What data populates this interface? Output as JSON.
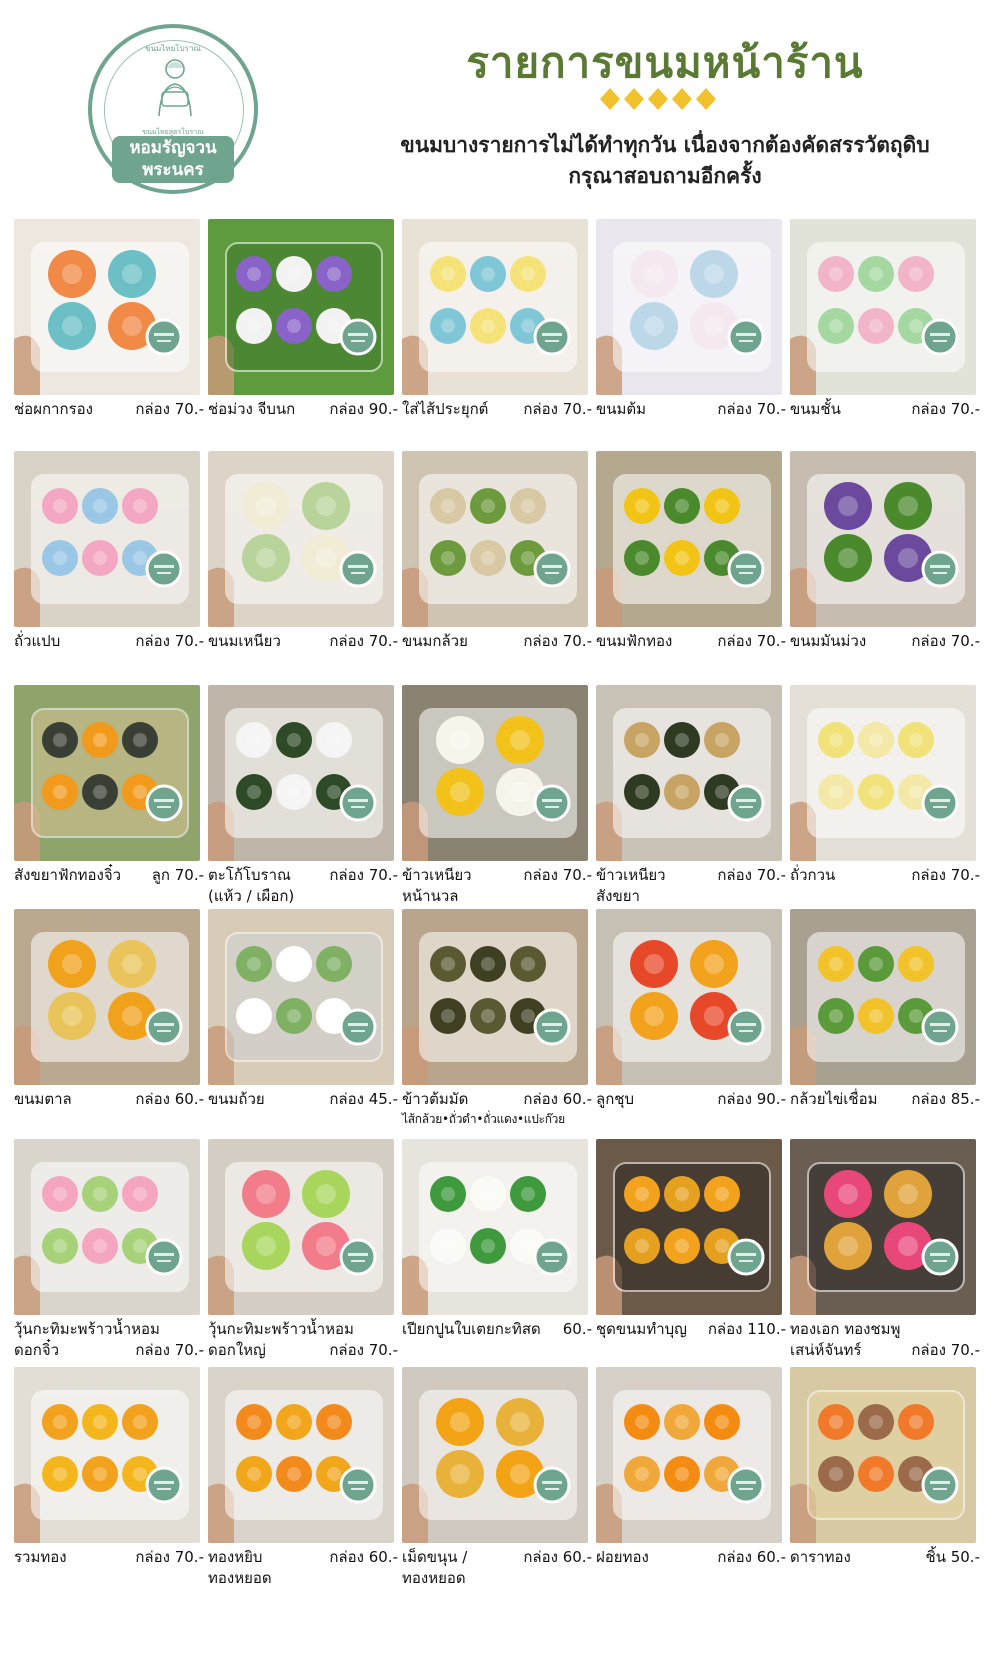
{
  "header": {
    "logo_top_text": "ขนมไทยโบราณ",
    "logo_mid_text": "ขนมไทยสูตรโบราณ",
    "logo_name_line1": "หอมรัญจวน",
    "logo_name_line2": "พระนคร",
    "title": "รายการขนมหน้าร้าน",
    "subtitle_line1": "ขนมบางรายการไม่ได้ทำทุกวัน เนื่องจากต้องคัดสรรวัตถุดิบ",
    "subtitle_line2": "กรุณาสอบถามอีกครั้ง"
  },
  "colors": {
    "brand_green": "#6fa58f",
    "title_olive": "#5a7a33",
    "diamond_gold": "#f2c12e"
  },
  "items": [
    {
      "name": "ช่อผกากรอง",
      "price": "กล่อง 70.-",
      "photo": "four colorful piped flower cakes in box"
    },
    {
      "name": "ช่อม่วง จีบนก",
      "price": "กล่อง 90.-",
      "photo": "purple flower dumplings on lettuce"
    },
    {
      "name": "ใส่ไส้ประยุกต์",
      "price": "กล่อง 70.-",
      "photo": "pastel round desserts in box"
    },
    {
      "name": "ขนมต้ม",
      "price": "กล่อง 70.-",
      "photo": "coconut coated balls in box"
    },
    {
      "name": "ขนมชั้น",
      "price": "กล่อง 70.-",
      "photo": "pastel flower layer cakes in box"
    },
    {
      "name": "ถั่วแปบ",
      "price": "กล่อง 70.-",
      "photo": "colored shredded coconut dessert"
    },
    {
      "name": "ขนมเหนียว",
      "price": "กล่อง 70.-",
      "photo": "sticky rice dessert in box"
    },
    {
      "name": "ขนมกล้วย",
      "price": "กล่อง 70.-",
      "photo": "banana flower cakes in box"
    },
    {
      "name": "ขนมฟักทอง",
      "price": "กล่อง 70.-",
      "photo": "yellow pumpkin flower cakes"
    },
    {
      "name": "ขนมมันม่วง",
      "price": "กล่อง 70.-",
      "photo": "purple potato flower cakes"
    },
    {
      "name": "สังขยาฟักทองจิ๋ว",
      "price": "ลูก 70.-",
      "photo": "mini pumpkins with custard"
    },
    {
      "name": "ตะโก้โบราณ",
      "name2": "(แห้ว / เผือก)",
      "price": "กล่อง 70.-",
      "photo": "white coconut cups in leaf"
    },
    {
      "name": "ข้าวเหนียว",
      "name2": "หน้านวล",
      "price": "กล่อง 70.-",
      "photo": "egg like rice cups"
    },
    {
      "name": "ข้าวเหนียว",
      "name2": "สังขยา",
      "price": "กล่อง 70.-",
      "photo": "custard topped sticky rice"
    },
    {
      "name": "ถั่วกวน",
      "price": "กล่อง 70.-",
      "photo": "yellow mung bean molded cakes"
    },
    {
      "name": "ขนมตาล",
      "price": "กล่อง 60.-",
      "photo": "orange palm cakes"
    },
    {
      "name": "ขนมถ้วย",
      "price": "กล่อง 45.-",
      "photo": "green cup cakes in foil"
    },
    {
      "name": "ข้าวต้มมัด",
      "note": "ไส้กล้วย•ถั่วดำ•ถั่วแดง•แปะก๊วย",
      "price": "กล่อง 60.-",
      "photo": "leaf wrapped sticky rice"
    },
    {
      "name": "ลูกชุบ",
      "price": "กล่อง 90.-",
      "photo": "mini fruit shaped candies"
    },
    {
      "name": "กล้วยไข่เชื่อม",
      "price": "กล่อง 85.-",
      "photo": "candied bananas in box"
    },
    {
      "name": "วุ้นกะทิมะพร้าวน้ำหอม",
      "name2": "ดอกจิ๋ว",
      "price": "กล่อง 70.-",
      "price_low": true,
      "photo": "small colorful jelly flowers"
    },
    {
      "name": "วุ้นกะทิมะพร้าวน้ำหอม",
      "name2": "ดอกใหญ่",
      "price": "กล่อง 70.-",
      "price_low": true,
      "photo": "large jelly flowers"
    },
    {
      "name": "เปียกปูนใบเตยกะทิสด",
      "price": "60.-",
      "photo": "green pandan cups with coconut cream"
    },
    {
      "name": "ชุดขนมทำบุญ",
      "price": "กล่อง 110.-",
      "photo": "golden dessert set"
    },
    {
      "name": "ทองเอก ทองชมพู",
      "name2": "เสน่ห์จันทร์",
      "price": "กล่อง 70.-",
      "price_low": true,
      "photo": "gold desserts in black tray"
    },
    {
      "name": "รวมทอง",
      "price": "กล่อง 70.-",
      "photo": "mixed golden desserts"
    },
    {
      "name": "ทองหยิบ",
      "name2": "ทองหยอด",
      "price": "กล่อง 60.-",
      "photo": "golden flower desserts"
    },
    {
      "name": "เม็ดขนุน /",
      "name2": "ทองหยอด",
      "price": "กล่อง 60.-",
      "photo": "golden drops in box"
    },
    {
      "name": "ฝอยทอง",
      "price": "กล่อง 60.-",
      "photo": "golden threads in box"
    },
    {
      "name": "ดาราทอง",
      "price": "ชิ้น 50.-",
      "photo": "single golden flower tart"
    }
  ]
}
